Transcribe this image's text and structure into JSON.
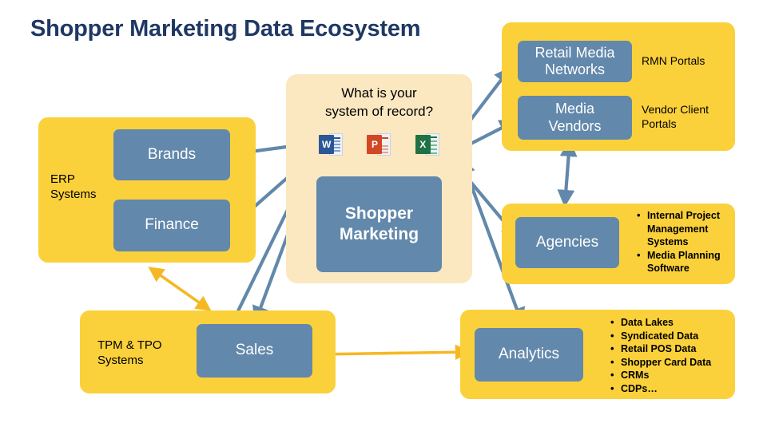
{
  "page": {
    "title": "Shopper Marketing Data Ecosystem",
    "title_color": "#1f3864",
    "background": "#ffffff"
  },
  "colors": {
    "group_yellow": "#fbd13b",
    "node_blue": "#6288ab",
    "center_cream": "#fbe8c0",
    "blue_arrow": "#6288ab",
    "yellow_arrow": "#f5b823"
  },
  "center": {
    "question": "What is your\nsystem of record?",
    "main_node": "Shopper\nMarketing",
    "office_icons": [
      {
        "name": "word-icon",
        "letter": "W",
        "color": "#2b5797"
      },
      {
        "name": "powerpoint-icon",
        "letter": "P",
        "color": "#d24726"
      },
      {
        "name": "excel-icon",
        "letter": "X",
        "color": "#207245"
      }
    ]
  },
  "groups": {
    "erp": {
      "label": "ERP\nSystems",
      "nodes": [
        {
          "name": "brands",
          "label": "Brands"
        },
        {
          "name": "finance",
          "label": "Finance"
        }
      ]
    },
    "media": {
      "nodes": [
        {
          "name": "retail-media-networks",
          "label": "Retail Media\nNetworks",
          "caption": "RMN Portals"
        },
        {
          "name": "media-vendors",
          "label": "Media\nVendors",
          "caption": "Vendor Client\nPortals"
        }
      ]
    },
    "agencies": {
      "node": "Agencies",
      "bullets": [
        "Internal Project",
        "Management",
        "Systems",
        "Media Planning",
        "Software"
      ],
      "bullet_items": [
        "Internal Project Management Systems",
        "Media Planning Software"
      ]
    },
    "tpm": {
      "label": "TPM & TPO\nSystems",
      "node": "Sales"
    },
    "analytics": {
      "node": "Analytics",
      "bullets": [
        "Data Lakes",
        "Syndicated Data",
        "Retail POS Data",
        "Shopper Card Data",
        "CRMs",
        "CDPs…"
      ]
    }
  }
}
